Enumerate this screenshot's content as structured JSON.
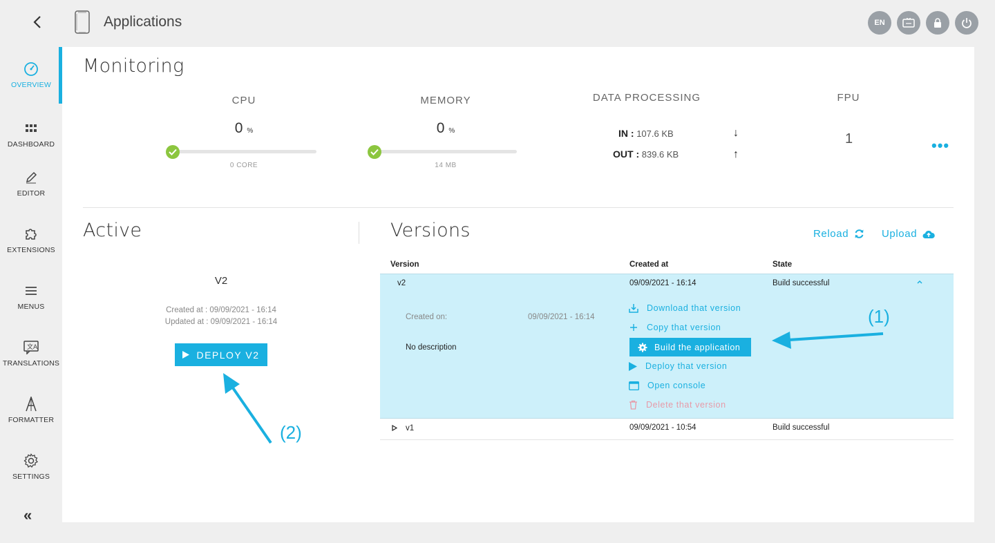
{
  "header": {
    "title": "Applications",
    "back_icon": "chevron-left-icon",
    "app_icon": "mobile-icon",
    "actions": [
      {
        "name": "language-button",
        "label": "EN"
      },
      {
        "name": "display-button",
        "icon": "screen-icon"
      },
      {
        "name": "lock-button",
        "icon": "lock-icon"
      },
      {
        "name": "power-button",
        "icon": "power-icon"
      }
    ]
  },
  "sidebar": {
    "items": [
      {
        "label": "OVERVIEW",
        "icon": "speedometer-icon",
        "active": true
      },
      {
        "label": "DASHBOARD",
        "icon": "grid-icon"
      },
      {
        "label": "EDITOR",
        "icon": "pencil-icon"
      },
      {
        "label": "EXTENSIONS",
        "icon": "puzzle-icon"
      },
      {
        "label": "MENUS",
        "icon": "hamburger-icon"
      },
      {
        "label": "TRANSLATIONS",
        "icon": "translate-icon"
      },
      {
        "label": "FORMATTER",
        "icon": "formatter-icon"
      },
      {
        "label": "SETTINGS",
        "icon": "gear-icon"
      }
    ],
    "collapse_label": "«"
  },
  "monitoring": {
    "title": "Monitoring",
    "cpu": {
      "label": "CPU",
      "value": "0",
      "unit": "%",
      "sub": "0 CORE",
      "progress": 0
    },
    "memory": {
      "label": "MEMORY",
      "value": "0",
      "unit": "%",
      "sub": "14 MB",
      "progress": 0
    },
    "data_processing": {
      "label": "DATA PROCESSING",
      "in_label": "IN :",
      "in_value": "107.6 KB",
      "out_label": "OUT :",
      "out_value": "839.6 KB"
    },
    "fpu": {
      "label": "FPU",
      "value": "1"
    },
    "more_label": "•••"
  },
  "active": {
    "title": "Active",
    "version": "V2",
    "created": "Created at : 09/09/2021 - 16:14",
    "updated": "Updated at : 09/09/2021 - 16:14",
    "deploy_label": "DEPLOY V2"
  },
  "versions": {
    "title": "Versions",
    "reload_label": "Reload",
    "upload_label": "Upload",
    "columns": {
      "version": "Version",
      "created": "Created at",
      "state": "State"
    },
    "expanded": {
      "version": "v2",
      "created": "09/09/2021 - 16:14",
      "state": "Build successful",
      "created_on_label": "Created on:",
      "created_on_value": "09/09/2021 - 16:14",
      "description": "No description",
      "actions": {
        "download": "Download that version",
        "copy": "Copy that version",
        "build": "Build the application",
        "deploy": "Deploy that version",
        "console": "Open console",
        "delete": "Delete that version"
      }
    },
    "rows": [
      {
        "version": "v1",
        "created": "09/09/2021 - 10:54",
        "state": "Build successful"
      }
    ]
  },
  "annotations": {
    "callout_1": "(1)",
    "callout_2": "(2)"
  },
  "colors": {
    "accent": "#1ab0e0",
    "success": "#8cc63f",
    "danger": "#e79aa8",
    "row_highlight": "#cdf0fa"
  }
}
